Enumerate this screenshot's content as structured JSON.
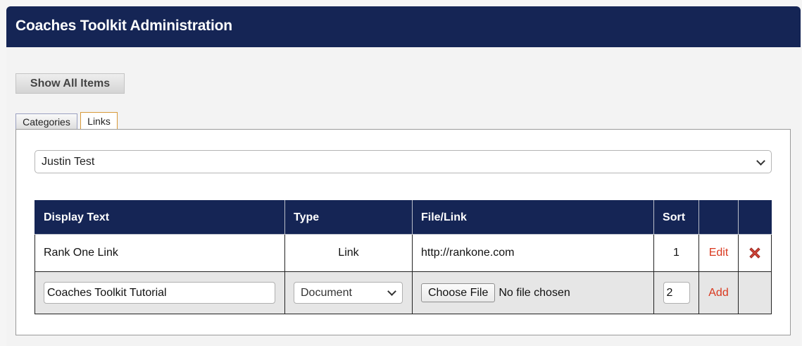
{
  "header": {
    "title": "Coaches Toolkit Administration"
  },
  "toolbar": {
    "show_all_label": "Show All Items"
  },
  "tabs": [
    {
      "label": "Categories",
      "active": false
    },
    {
      "label": "Links",
      "active": true
    }
  ],
  "category_select": {
    "value": "Justin Test"
  },
  "table": {
    "headers": [
      "Display Text",
      "Type",
      "File/Link",
      "Sort",
      "",
      ""
    ],
    "rows": [
      {
        "display_text": "Rank One Link",
        "type": "Link",
        "file_link": "http://rankone.com",
        "sort": "1",
        "edit_label": "Edit",
        "delete_icon": "delete-x-icon"
      }
    ],
    "new_row": {
      "display_text_value": "Coaches Toolkit Tutorial",
      "type_value": "Document",
      "choose_file_label": "Choose File",
      "file_status": "No file chosen",
      "sort_value": "2",
      "add_label": "Add"
    }
  },
  "colors": {
    "header_bg": "#152555",
    "action_link": "#d9381e",
    "delete_icon": "#d0453a"
  }
}
